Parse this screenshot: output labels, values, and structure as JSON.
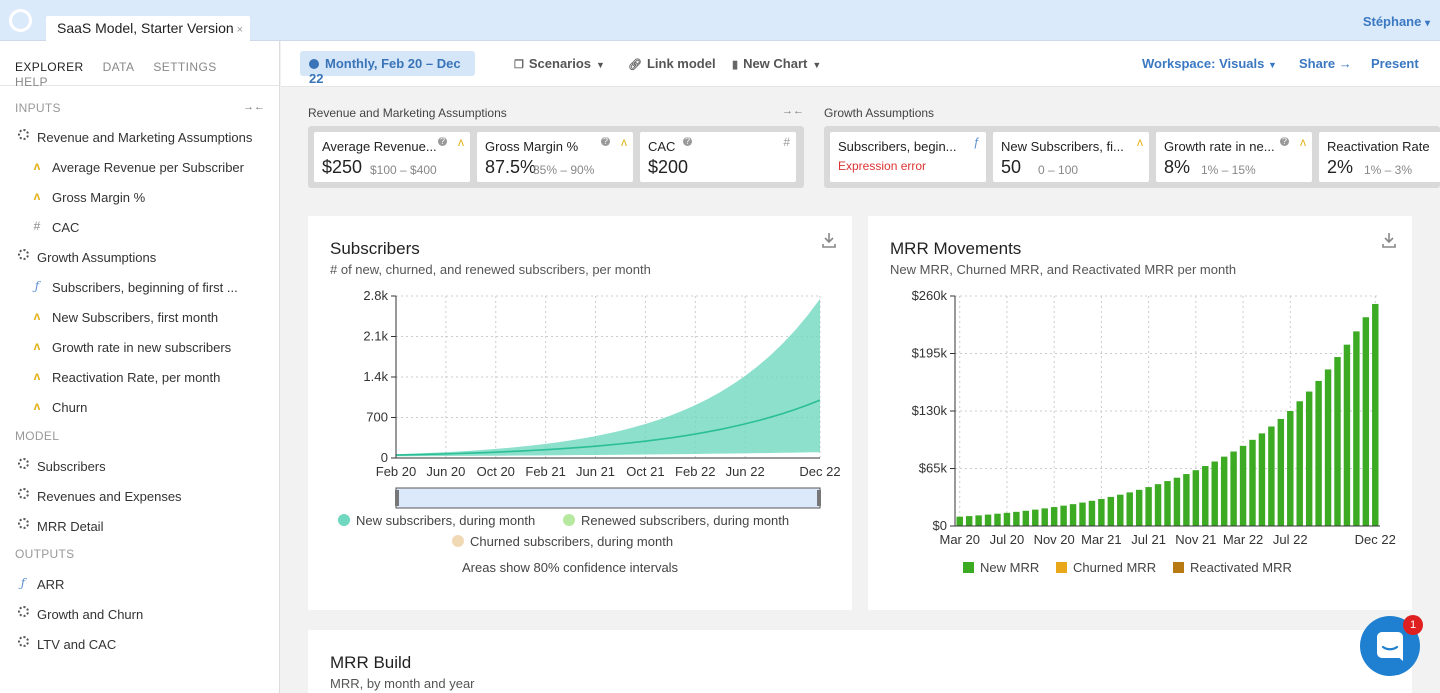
{
  "app": {
    "doc_tab": "SaaS Model, Starter Version",
    "close_glyph": "×",
    "user": "Stéphane",
    "user_caret": "▾"
  },
  "sidebar": {
    "tabs": [
      "EXPLORER",
      "DATA",
      "SETTINGS",
      "HELP"
    ],
    "inputs_label": "INPUTS",
    "collapse_glyph": "→←",
    "inputs": [
      {
        "label": "Revenue and Marketing Assumptions",
        "icon": "group-icon",
        "indent": 0
      },
      {
        "label": "Average Revenue per Subscriber",
        "icon": "distribution-icon",
        "indent": 1
      },
      {
        "label": "Gross Margin %",
        "icon": "distribution-icon",
        "indent": 1
      },
      {
        "label": "CAC",
        "icon": "number-icon",
        "indent": 1
      },
      {
        "label": "Growth Assumptions",
        "icon": "group-icon",
        "indent": 0
      },
      {
        "label": "Subscribers, beginning of first ...",
        "icon": "function-icon",
        "indent": 1
      },
      {
        "label": "New Subscribers, first month",
        "icon": "distribution-icon",
        "indent": 1
      },
      {
        "label": "Growth rate in new subscribers",
        "icon": "distribution-icon",
        "indent": 1
      },
      {
        "label": "Reactivation Rate, per month",
        "icon": "distribution-icon",
        "indent": 1
      },
      {
        "label": "Churn",
        "icon": "distribution-icon",
        "indent": 1
      }
    ],
    "model_label": "MODEL",
    "model": [
      {
        "label": "Subscribers",
        "icon": "group-icon"
      },
      {
        "label": "Revenues and Expenses",
        "icon": "group-icon"
      },
      {
        "label": "MRR Detail",
        "icon": "group-icon"
      }
    ],
    "outputs_label": "OUTPUTS",
    "outputs": [
      {
        "label": "ARR",
        "icon": "function-icon"
      },
      {
        "label": "Growth and Churn",
        "icon": "group-icon"
      },
      {
        "label": "LTV and CAC",
        "icon": "group-icon"
      }
    ]
  },
  "toolbar": {
    "period": "Monthly, Feb 20 – Dec 22",
    "scenarios": "Scenarios",
    "link_model": "Link model",
    "new_chart": "New Chart",
    "workspace": "Workspace: Visuals",
    "share": "Share →",
    "present": "Present"
  },
  "input_groups": [
    {
      "title": "Revenue and Marketing Assumptions",
      "collapse_glyph": "→←",
      "cards": [
        {
          "title": "Average Revenue...",
          "value": "$250",
          "range": "$100 – $400",
          "type": "distribution-icon",
          "help": true
        },
        {
          "title": "Gross Margin %",
          "value": "87.5%",
          "range": "85% – 90%",
          "type": "distribution-icon",
          "help": true
        },
        {
          "title": "CAC",
          "value": "$200",
          "range": "",
          "type": "number-icon",
          "help": true
        }
      ]
    },
    {
      "title": "Growth Assumptions",
      "cards": [
        {
          "title": "Subscribers, begin...",
          "value": "",
          "error": "Expression error",
          "range": "",
          "type": "function-icon",
          "help": false
        },
        {
          "title": "New Subscribers, fi...",
          "value": "50",
          "range": "0 – 100",
          "type": "distribution-icon",
          "help": false
        },
        {
          "title": "Growth rate in ne...",
          "value": "8%",
          "range": "1% – 15%",
          "type": "distribution-icon",
          "help": true
        },
        {
          "title": "Reactivation Rate",
          "value": "2%",
          "range": "1% – 3%",
          "type": "distribution-icon",
          "help": false
        }
      ]
    }
  ],
  "charts": {
    "subscribers": {
      "title": "Subscribers",
      "subtitle": "# of new, churned, and renewed subscribers, per month",
      "note": "Areas show 80% confidence intervals"
    },
    "mrr": {
      "title": "MRR Movements",
      "subtitle": "New MRR, Churned MRR, and Reactivated MRR per month"
    },
    "build": {
      "title": "MRR Build",
      "subtitle": "MRR, by month and year"
    }
  },
  "chart_data": [
    {
      "type": "area",
      "x": [
        "Feb 20",
        "Mar 20",
        "Apr 20",
        "May 20",
        "Jun 20",
        "Jul 20",
        "Aug 20",
        "Sep 20",
        "Oct 20",
        "Nov 20",
        "Dec 20",
        "Jan 21",
        "Feb 21",
        "Mar 21",
        "Apr 21",
        "May 21",
        "Jun 21",
        "Jul 21",
        "Aug 21",
        "Sep 21",
        "Oct 21",
        "Nov 21",
        "Dec 21",
        "Jan 22",
        "Feb 22",
        "Mar 22",
        "Apr 22",
        "May 22",
        "Jun 22",
        "Jul 22",
        "Aug 22",
        "Sep 22",
        "Oct 22",
        "Nov 22",
        "Dec 22"
      ],
      "x_ticks": [
        "Feb 20",
        "Jun 20",
        "Oct 20",
        "Feb 21",
        "Jun 21",
        "Oct 21",
        "Feb 22",
        "Jun 22",
        "Dec 22"
      ],
      "y_ticks": [
        "0",
        "700",
        "1.4k",
        "2.1k",
        "2.8k"
      ],
      "ylim": [
        0,
        2800
      ],
      "series": [
        {
          "name": "New subscribers, during month",
          "color": "#6fd8bf",
          "median": {
            "start": 50,
            "end": 1000
          },
          "band_low": {
            "start": 30,
            "end": 100
          },
          "band_high": {
            "start": 65,
            "end": 2750
          }
        },
        {
          "name": "Renewed subscribers, during month",
          "color": "#b6e8a0"
        },
        {
          "name": "Churned subscribers, during month",
          "color": "#f1d9b5"
        }
      ]
    },
    {
      "type": "bar",
      "x_ticks": [
        "Mar 20",
        "Jul 20",
        "Nov 20",
        "Mar 21",
        "Jul 21",
        "Nov 21",
        "Mar 22",
        "Jul 22",
        "Dec 22"
      ],
      "y_ticks": [
        "$0",
        "$65k",
        "$130k",
        "$195k",
        "$260k"
      ],
      "ylim": [
        0,
        260000
      ],
      "series": [
        {
          "name": "New MRR",
          "color": "#3daa24",
          "values": [
            10500,
            11200,
            12000,
            12900,
            13900,
            14900,
            16000,
            17200,
            18500,
            19900,
            21400,
            23000,
            24700,
            26500,
            28500,
            30600,
            32900,
            35400,
            38000,
            40900,
            44000,
            47300,
            50800,
            54600,
            58700,
            63100,
            67800,
            72900,
            78400,
            84200,
            90600,
            97400,
            104700,
            112500,
            121000,
            130000,
            141000,
            152000,
            164000,
            177000,
            191000,
            205000,
            220000,
            236000,
            251000
          ]
        },
        {
          "name": "Churned MRR",
          "color": "#e8a81a",
          "values": []
        },
        {
          "name": "Reactivated MRR",
          "color": "#b87a12",
          "values": []
        }
      ]
    }
  ]
}
